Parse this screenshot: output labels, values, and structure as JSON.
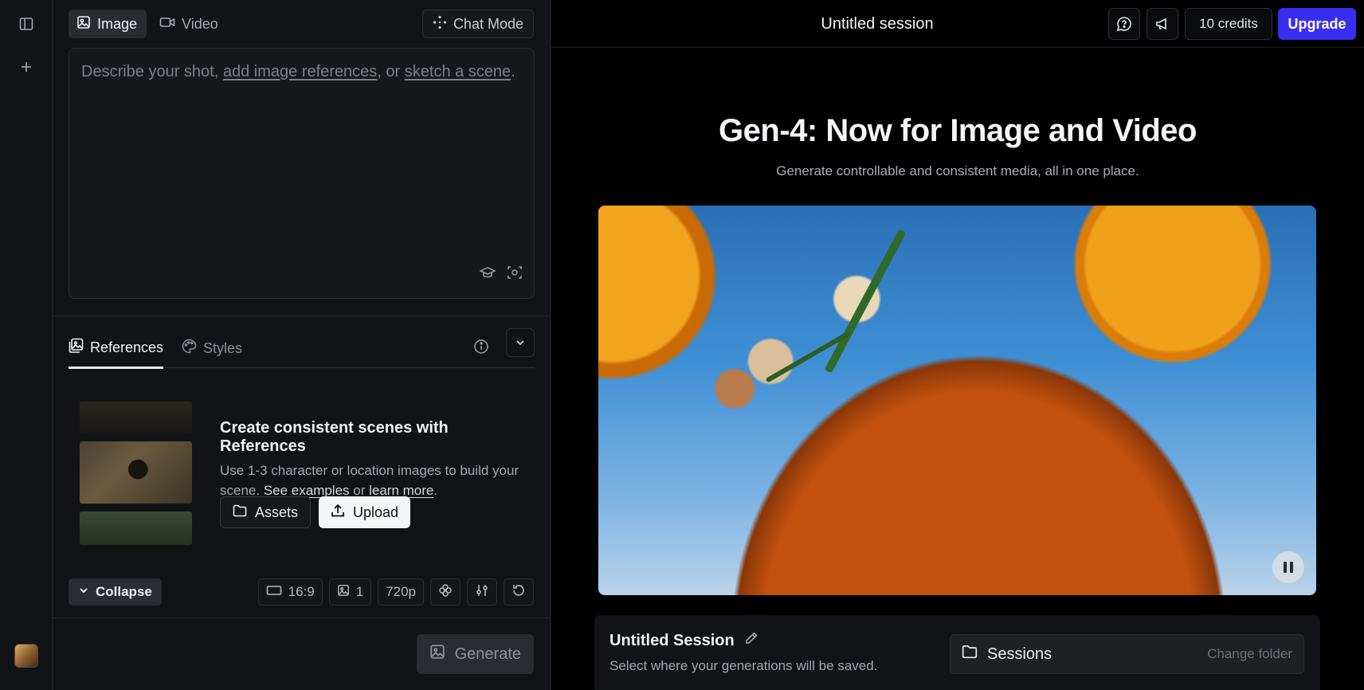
{
  "sidebar": {
    "toggle_icon": "sidebar-toggle-icon",
    "new_icon": "plus-icon"
  },
  "mode_tabs": [
    {
      "label": "Image",
      "icon": "image-icon",
      "active": true
    },
    {
      "label": "Video",
      "icon": "video-camera-icon",
      "active": false
    }
  ],
  "chat_mode": {
    "label": "Chat Mode",
    "icon": "sparkle-dots-icon"
  },
  "prompt": {
    "placeholder_prefix": "Describe your shot, ",
    "link_add_refs": "add image references",
    "middle": ", or ",
    "link_sketch": "sketch a scene",
    "suffix": "."
  },
  "ref_tabs": [
    {
      "label": "References",
      "active": true
    },
    {
      "label": "Styles",
      "active": false
    }
  ],
  "references": {
    "heading": "Create consistent scenes with References",
    "body": "Use 1-3 character or location images to build your scene. ",
    "link_examples": "See examples",
    "or": " or ",
    "link_learn": "learn more",
    "period": ".",
    "assets_label": "Assets",
    "upload_label": "Upload"
  },
  "controls": {
    "collapse_label": "Collapse",
    "aspect": "16:9",
    "count": "1",
    "resolution": "720p"
  },
  "generate_label": "Generate",
  "topbar": {
    "session_title": "Untitled session",
    "credits": "10 credits",
    "upgrade": "Upgrade"
  },
  "hero": {
    "title": "Gen-4: Now for Image and Video",
    "subtitle": "Generate controllable and consistent media, all in one place."
  },
  "session_panel": {
    "name": "Untitled Session",
    "description": "Select where your generations will be saved.",
    "sessions_label": "Sessions",
    "change_folder": "Change folder"
  },
  "colors": {
    "accent": "#3a2df0",
    "panel_bg": "#121316",
    "main_bg": "#000000"
  }
}
